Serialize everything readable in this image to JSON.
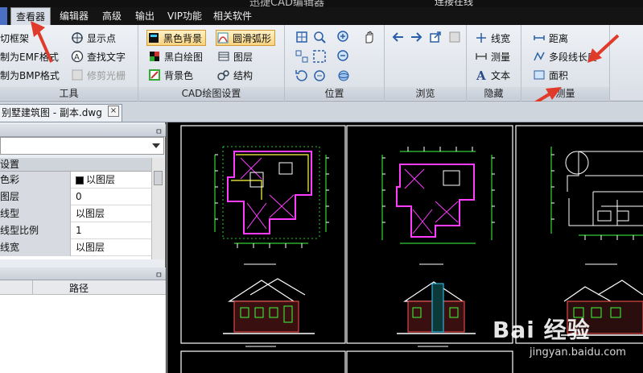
{
  "titlebar": {
    "title": "迅捷CAD编辑器",
    "right_text": "连接在线"
  },
  "menu": {
    "items": [
      {
        "label": "查看器",
        "active": true
      },
      {
        "label": "编辑器"
      },
      {
        "label": "高级"
      },
      {
        "label": "输出"
      },
      {
        "label": "VIP功能"
      },
      {
        "label": "相关软件"
      }
    ]
  },
  "ribbon": {
    "tools": {
      "label": "工具",
      "items": [
        "切框架",
        "制为EMF格式",
        "制为BMP格式"
      ],
      "items2": [
        "显示点",
        "查找文字",
        "修剪光栅"
      ]
    },
    "cad_settings": {
      "label": "CAD绘图设置",
      "col1": [
        "黑色背景",
        "黑白绘图",
        "背景色"
      ],
      "col2": [
        "圆滑弧形",
        "图层",
        "结构"
      ]
    },
    "position": {
      "label": "位置"
    },
    "browse": {
      "label": "浏览"
    },
    "hide": {
      "label": "隐藏",
      "items": [
        "线宽",
        "测量",
        "文本"
      ]
    },
    "measure": {
      "label": "测量",
      "items": [
        "距离",
        "多段线长度",
        "面积"
      ]
    }
  },
  "document": {
    "tab_label": "别墅建筑图 - 副本.dwg",
    "close_glyph": "×"
  },
  "properties": {
    "header": "设置",
    "rows": [
      {
        "name": "色彩",
        "value": "以图层",
        "swatch": true
      },
      {
        "name": "图层",
        "value": "0"
      },
      {
        "name": "线型",
        "value": "以图层"
      },
      {
        "name": "线型比例",
        "value": "1"
      },
      {
        "name": "线宽",
        "value": "以图层"
      }
    ],
    "pin_glyph": "ㅁ"
  },
  "layers_panel": {
    "column_path": "路径",
    "pin_glyph": "ㅁ"
  },
  "watermark": {
    "text": "Bai 经验",
    "url": "jingyan.baidu.com"
  },
  "colors": {
    "accent_red": "#e03a2a",
    "cad_bg": "#000000",
    "cad_white": "#ffffff",
    "cad_magenta": "#ff3cff",
    "cad_green": "#3cff3c",
    "cad_yellow": "#ffff40"
  }
}
